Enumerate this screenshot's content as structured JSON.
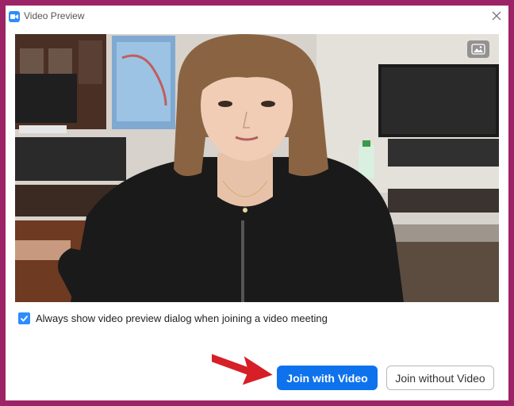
{
  "window": {
    "title": "Video Preview"
  },
  "icons": {
    "app": "camera-icon",
    "close": "close-icon",
    "background": "image-icon",
    "checkmark": "checkmark-icon",
    "annotation": "red-arrow"
  },
  "preview": {
    "description_visible_only": true,
    "background_button": "change-background"
  },
  "options": {
    "always_show_label": "Always show video preview dialog when joining a video meeting",
    "always_show_checked": true
  },
  "buttons": {
    "join_with_video": "Join with Video",
    "join_without_video": "Join without Video"
  },
  "colors": {
    "frame": "#9c2466",
    "primary": "#0e72ed",
    "checkbox": "#2d8cff",
    "arrow": "#d61f26"
  }
}
